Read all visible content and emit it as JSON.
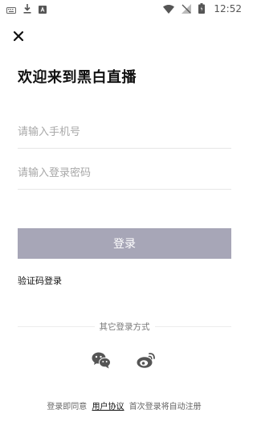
{
  "status_bar": {
    "time": "12:52",
    "icons": [
      "keyboard-icon",
      "download-icon",
      "notification-app-icon",
      "wifi-icon",
      "no-signal-icon",
      "battery-icon"
    ]
  },
  "header": {
    "close_icon": "close-icon",
    "welcome_title": "欢迎来到黑白直播"
  },
  "form": {
    "phone_placeholder": "请输入手机号",
    "password_placeholder": "请输入登录密码",
    "login_button": "登录",
    "sms_login_link": "验证码登录"
  },
  "other_login": {
    "label": "其它登录方式",
    "options": [
      "wechat-icon",
      "weibo-icon"
    ]
  },
  "agreement": {
    "prefix": "登录即同意",
    "link": "用户协议",
    "suffix": "首次登录将自动注册"
  },
  "colors": {
    "login_button_bg": "#a7a6b7",
    "placeholder": "#a8a8a8",
    "divider": "#e6e6e6"
  }
}
